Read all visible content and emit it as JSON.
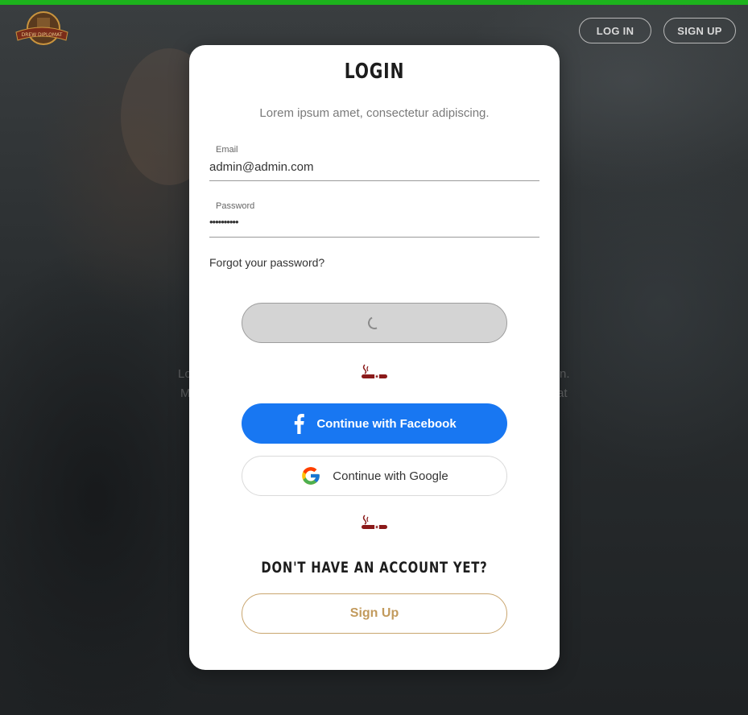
{
  "header": {
    "logo_icon": "drew-diplomat-logo",
    "logo_text": "DREW DIPLOMAT",
    "login_label": "LOG IN",
    "signup_label": "SIGN UP"
  },
  "colors": {
    "top_bar": "#1db31d",
    "facebook": "#1877f2",
    "accent_gold": "#c29a5c",
    "cigar": "#8b1a1a"
  },
  "card": {
    "title": "LOGIN",
    "subtitle": "Lorem ipsum amet, consectetur adipiscing.",
    "email": {
      "label": "Email",
      "value": "admin@admin.com"
    },
    "password": {
      "label": "Password",
      "value": "••••••••••"
    },
    "forgot_label": "Forgot your password?",
    "login_button_state": "loading",
    "divider_icon": "cigar-icon",
    "facebook_label": "Continue with Facebook",
    "google_label": "Continue with Google",
    "no_account_text": "DON'T HAVE AN ACCOUNT YET?",
    "signup_label": "Sign Up"
  },
  "background": {
    "text_left_1": "Lo",
    "text_left_2": "M",
    "text_right_1": "n.",
    "text_right_2": "at"
  }
}
